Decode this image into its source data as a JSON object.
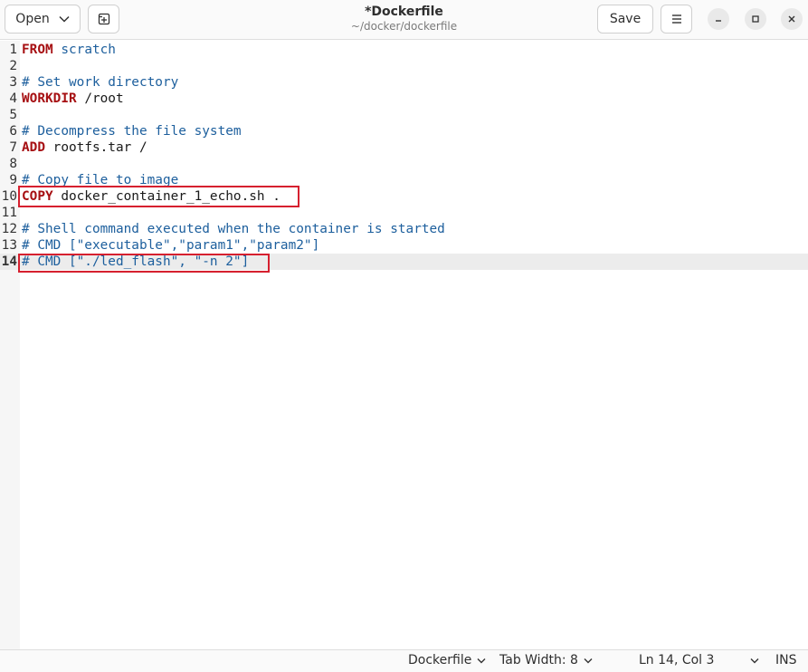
{
  "header": {
    "open_label": "Open",
    "save_label": "Save",
    "title": "*Dockerfile",
    "subtitle": "~/docker/dockerfile"
  },
  "editor": {
    "current_line": 14,
    "lines": [
      {
        "n": "1",
        "segs": [
          {
            "t": "FROM",
            "c": "kw"
          },
          {
            "t": " ",
            "c": "pl"
          },
          {
            "t": "scratch",
            "c": "ty"
          }
        ]
      },
      {
        "n": "2",
        "segs": []
      },
      {
        "n": "3",
        "segs": [
          {
            "t": "# Set work directory",
            "c": "cm"
          }
        ]
      },
      {
        "n": "4",
        "segs": [
          {
            "t": "WORKDIR",
            "c": "kw"
          },
          {
            "t": " /root",
            "c": "pl"
          }
        ]
      },
      {
        "n": "5",
        "segs": []
      },
      {
        "n": "6",
        "segs": [
          {
            "t": "# Decompress the file system",
            "c": "cm"
          }
        ]
      },
      {
        "n": "7",
        "segs": [
          {
            "t": "ADD",
            "c": "kw"
          },
          {
            "t": " rootfs.tar /",
            "c": "pl"
          }
        ]
      },
      {
        "n": "8",
        "segs": []
      },
      {
        "n": "9",
        "segs": [
          {
            "t": "# Copy file to image",
            "c": "cm"
          }
        ]
      },
      {
        "n": "10",
        "segs": [
          {
            "t": "COPY",
            "c": "kw"
          },
          {
            "t": " docker_container_1_echo.sh .",
            "c": "pl"
          }
        ]
      },
      {
        "n": "11",
        "segs": []
      },
      {
        "n": "12",
        "segs": [
          {
            "t": "# Shell command executed when the container is started",
            "c": "cm"
          }
        ]
      },
      {
        "n": "13",
        "segs": [
          {
            "t": "# CMD [\"executable\",\"param1\",\"param2\"]",
            "c": "cm"
          }
        ]
      },
      {
        "n": "14",
        "segs": [
          {
            "t": "# CMD [\"./led_flash\", \"-n 2\"]",
            "c": "cm"
          }
        ]
      }
    ]
  },
  "status": {
    "language": "Dockerfile",
    "tab_width": "Tab Width: 8",
    "position": "Ln 14, Col 3",
    "mode": "INS"
  },
  "colors": {
    "keyword": "#a60f12",
    "comment": "#1d5f9d",
    "highlight_box": "#d6202f"
  },
  "icons": [
    "chevron-down-icon",
    "new-tab-icon",
    "hamburger-menu-icon",
    "minimize-icon",
    "maximize-icon",
    "close-icon"
  ]
}
